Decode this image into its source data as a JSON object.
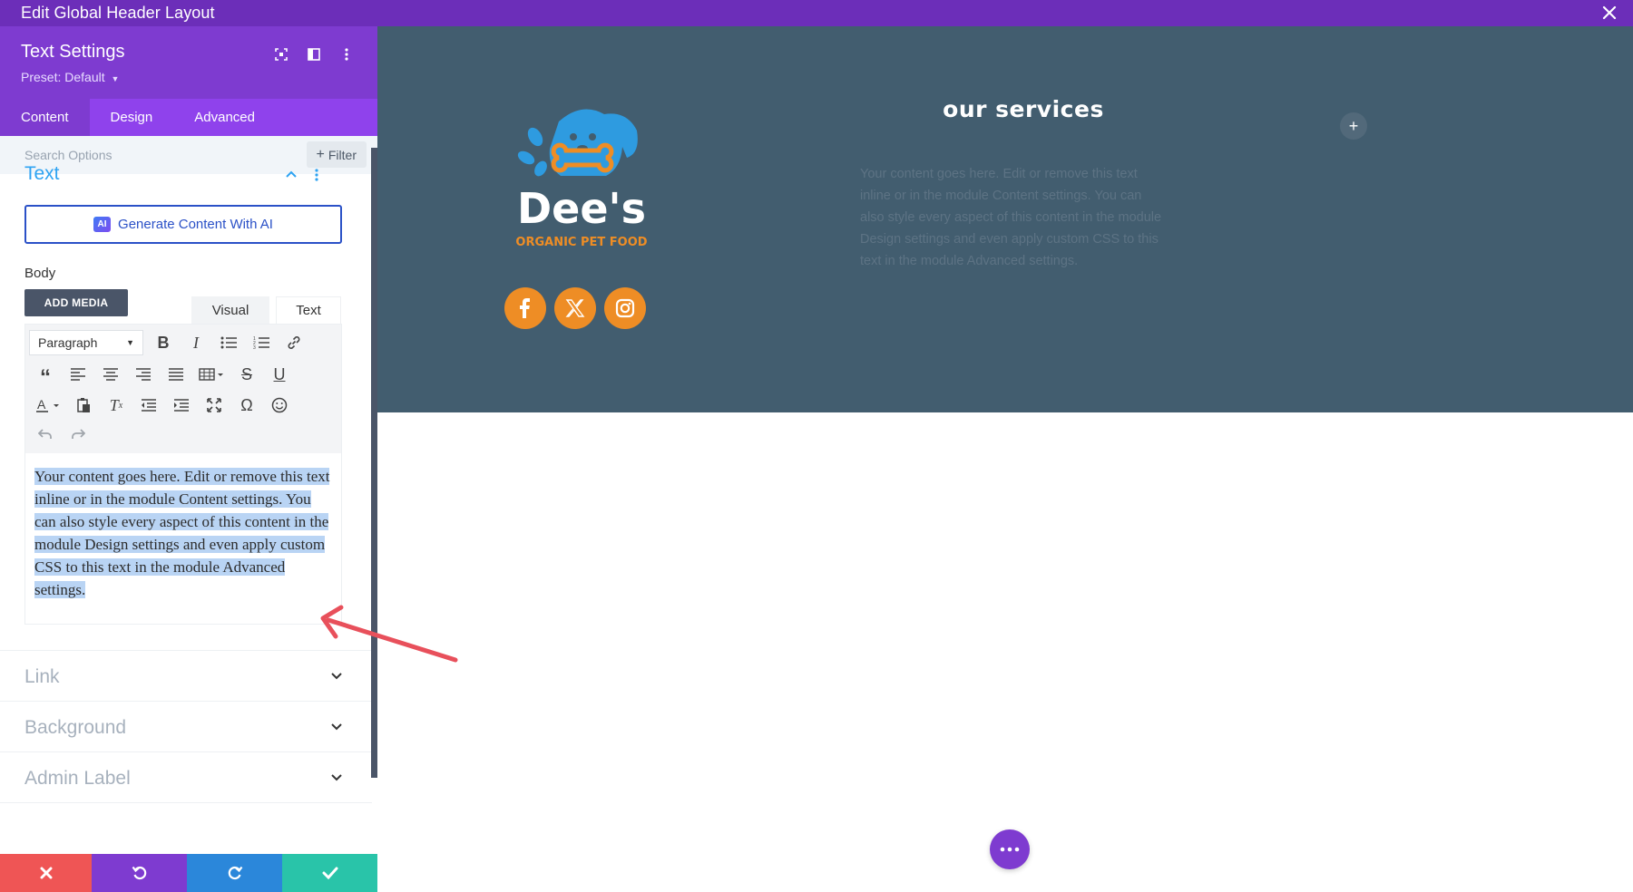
{
  "topbar": {
    "title": "Edit Global Header Layout"
  },
  "panel": {
    "title": "Text Settings",
    "preset": "Preset: Default",
    "tabs": [
      {
        "label": "Content",
        "active": true
      },
      {
        "label": "Design",
        "active": false
      },
      {
        "label": "Advanced",
        "active": false
      }
    ],
    "search_placeholder": "Search Options",
    "filter_label": "Filter",
    "sections": {
      "text": {
        "label": "Text",
        "ai_button": "Generate Content With AI",
        "ai_badge": "AI",
        "body_label": "Body",
        "add_media": "ADD MEDIA",
        "mode_visual": "Visual",
        "mode_text": "Text",
        "format_select": "Paragraph",
        "content": "Your content goes here. Edit or remove this text inline or in the module Content settings. You can also style every aspect of this content in the module Design settings and even apply custom CSS to this text in the module Advanced settings."
      },
      "link": {
        "label": "Link"
      },
      "background": {
        "label": "Background"
      },
      "admin_label": {
        "label": "Admin Label"
      }
    }
  },
  "canvas": {
    "services_title": "our services",
    "services_text": "Your content goes here. Edit or remove this text inline or in the module Content settings. You can also style every aspect of this content in the module Design settings and even apply custom CSS to this text in the module Advanced settings.",
    "logo_name": "Dee's",
    "logo_tagline": "ORGANIC PET FOOD"
  },
  "colors": {
    "topbar": "#6c2eb9",
    "panel_header": "#7e3bd0",
    "tabs": "#8f42ec",
    "accent_blue": "#2ea3f2",
    "header_bg": "#425d6f",
    "social_orange": "#ee8d25",
    "logo_blue": "#2e9be0"
  }
}
